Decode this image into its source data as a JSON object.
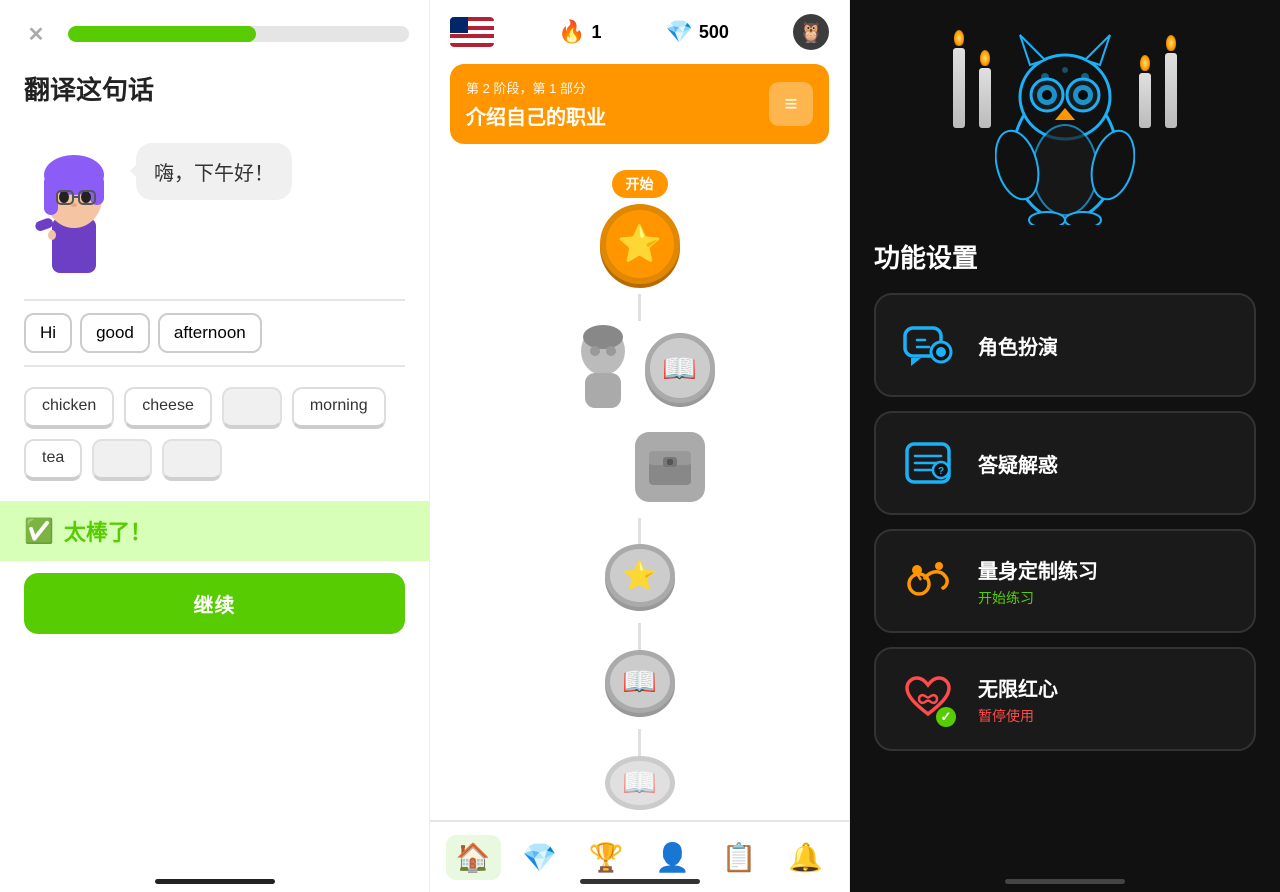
{
  "left": {
    "close_label": "✕",
    "progress_percent": 55,
    "translate_title": "翻译这句话",
    "speech_text": "嗨，下午好！",
    "selected_words": [
      "Hi",
      "good",
      "afternoon"
    ],
    "word_options": [
      {
        "label": "chicken",
        "empty": false
      },
      {
        "label": "cheese",
        "empty": false
      },
      {
        "label": "",
        "empty": true
      },
      {
        "label": "morning",
        "empty": false
      },
      {
        "label": "tea",
        "empty": false
      },
      {
        "label": "",
        "empty": true
      },
      {
        "label": "",
        "empty": true
      }
    ],
    "success_text": "太棒了！",
    "continue_label": "继续"
  },
  "middle": {
    "flame_count": "1",
    "gem_count": "500",
    "section_stage": "第 2 阶段，第 1 部分",
    "section_title": "介绍自己的职业",
    "section_icon": "≡",
    "start_label": "开始",
    "nav_items": [
      {
        "icon": "🏠",
        "active": true
      },
      {
        "icon": "💎",
        "active": false
      },
      {
        "icon": "🏆",
        "active": false
      },
      {
        "icon": "👤",
        "active": false
      },
      {
        "icon": "📋",
        "active": false
      },
      {
        "icon": "🔔",
        "active": false
      }
    ]
  },
  "right": {
    "features_title": "功能设置",
    "features": [
      {
        "name": "角色扮演",
        "sub": "",
        "icon_type": "roleplay"
      },
      {
        "name": "答疑解惑",
        "sub": "",
        "icon_type": "qa"
      },
      {
        "name": "量身定制练习",
        "sub": "开始练习",
        "sub_color": "green",
        "icon_type": "custom"
      },
      {
        "name": "无限红心",
        "sub": "暂停使用",
        "sub_color": "red",
        "icon_type": "heart"
      }
    ]
  }
}
